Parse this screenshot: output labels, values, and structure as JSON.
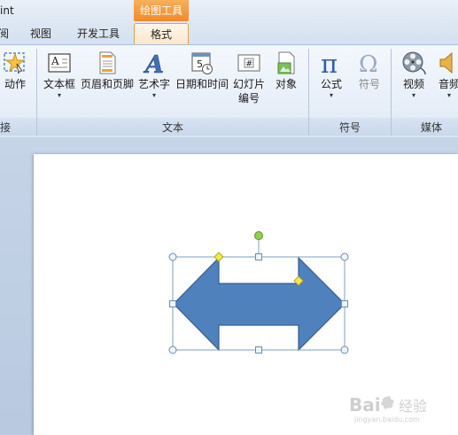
{
  "title_bar": {
    "app_title": "int",
    "context_tab_header": "绘图工具"
  },
  "tabs": [
    {
      "label": "阅",
      "active": false
    },
    {
      "label": "视图",
      "active": false
    },
    {
      "label": "开发工具",
      "active": false
    },
    {
      "label": "格式",
      "active": true
    }
  ],
  "ribbon": {
    "groups": [
      {
        "label": "接",
        "buttons": [
          {
            "label": "动作",
            "icon": "action-star-icon"
          }
        ]
      },
      {
        "label": "文本",
        "buttons": [
          {
            "label": "文本框",
            "icon": "textbox-icon",
            "dropdown": "▾"
          },
          {
            "label": "页眉和页脚",
            "icon": "header-footer-icon"
          },
          {
            "label": "艺术字",
            "icon": "wordart-icon",
            "dropdown": "▾"
          },
          {
            "label": "日期和时间",
            "icon": "date-time-icon"
          },
          {
            "label": "幻灯片",
            "label2": "编号",
            "icon": "slide-number-icon",
            "glyph": "#"
          },
          {
            "label": "对象",
            "icon": "object-icon"
          }
        ]
      },
      {
        "label": "符号",
        "buttons": [
          {
            "label": "公式",
            "icon": "pi-equation-icon",
            "glyph": "π",
            "dropdown": "▾"
          },
          {
            "label": "符号",
            "icon": "omega-symbol-icon",
            "glyph": "Ω",
            "disabled": true
          }
        ]
      },
      {
        "label": "媒体",
        "buttons": [
          {
            "label": "视频",
            "icon": "film-reel-icon",
            "dropdown": "▾"
          },
          {
            "label": "音频",
            "icon": "speaker-icon",
            "dropdown": "▾"
          }
        ]
      }
    ]
  },
  "textbox_glyph": "A",
  "wordart_glyph": "A",
  "date_glyph": "5",
  "colors": {
    "shape_fill": "#4f81bd",
    "shape_stroke": "#385d8a",
    "selection": "#7f9fbf",
    "rotate_handle": "#8fd14f",
    "adjust_handle": "#f5e653",
    "context_tab": "#f08a2a"
  },
  "watermark": {
    "brand": "Bai",
    "sub": "jingyan.baidu.com",
    "cn": "经验"
  }
}
